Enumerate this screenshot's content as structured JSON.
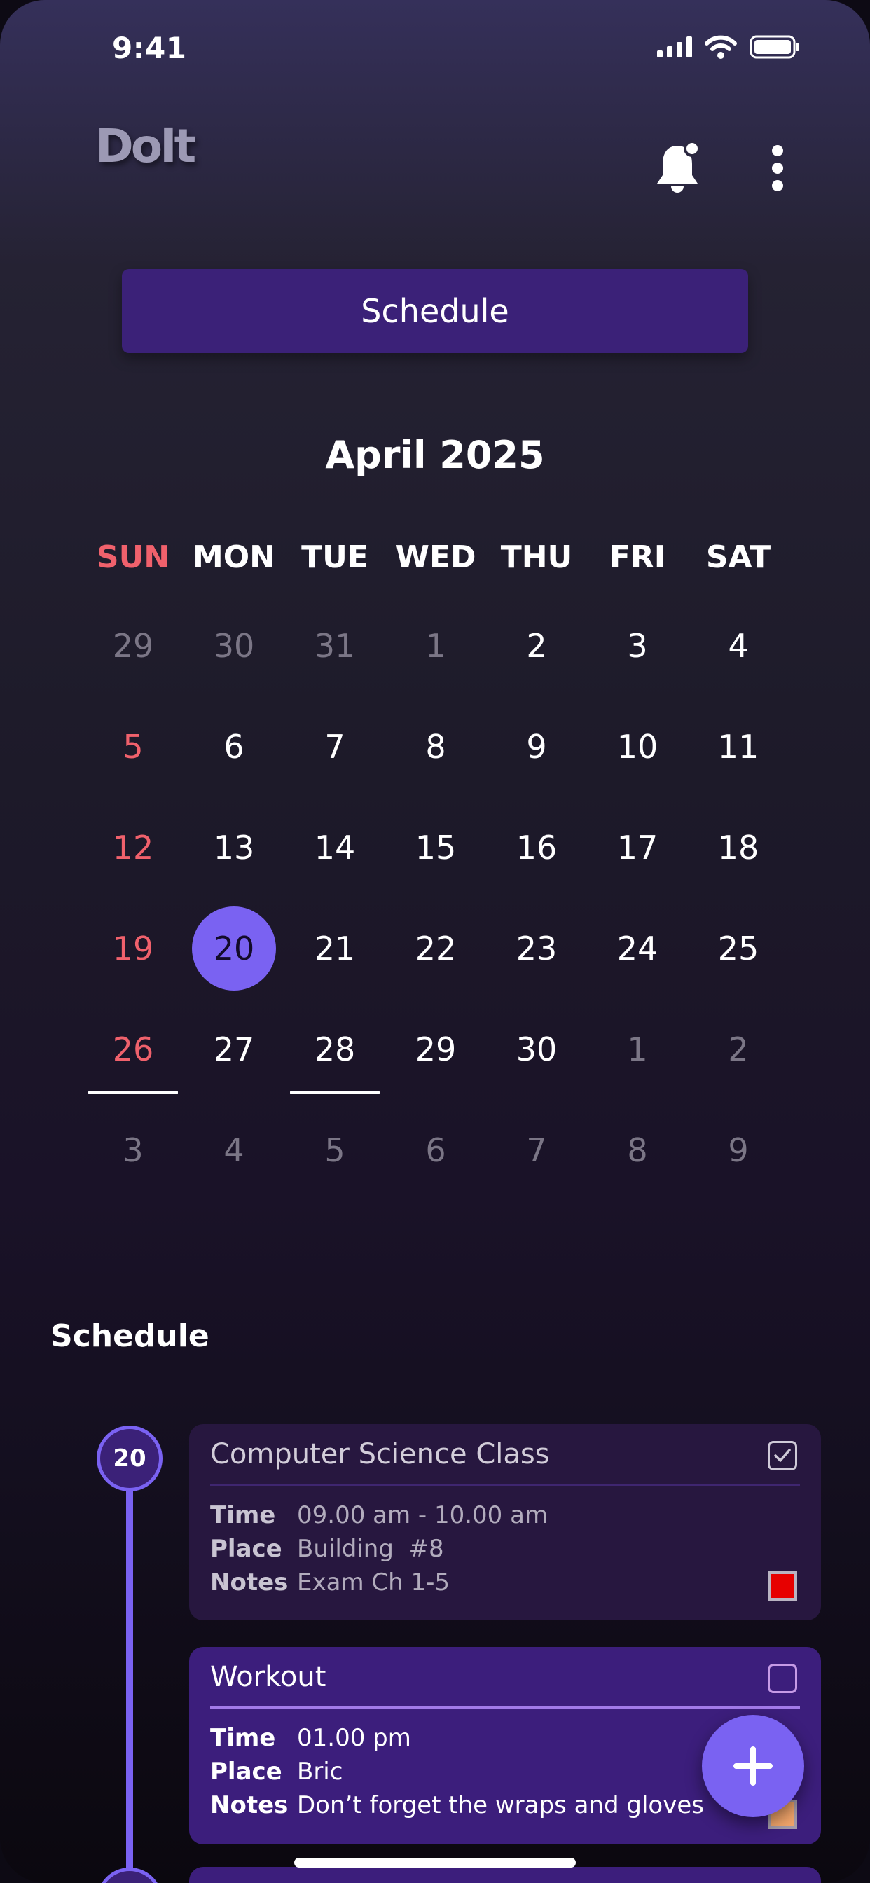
{
  "status_bar": {
    "time": "9:41",
    "icons": [
      "signal-icon",
      "wifi-icon",
      "battery-icon"
    ]
  },
  "header": {
    "logo_text": "DoIt",
    "icons": [
      "bell-icon",
      "more-vertical-icon"
    ]
  },
  "schedule_button": {
    "label": "Schedule"
  },
  "calendar": {
    "title": "April 2025",
    "weekdays": [
      "SUN",
      "MON",
      "TUE",
      "WED",
      "THU",
      "FRI",
      "SAT"
    ],
    "weeks": [
      [
        "29",
        "30",
        "31",
        "1",
        "2",
        "3",
        "4"
      ],
      [
        "5",
        "6",
        "7",
        "8",
        "9",
        "10",
        "11"
      ],
      [
        "12",
        "13",
        "14",
        "15",
        "16",
        "17",
        "18"
      ],
      [
        "19",
        "20",
        "21",
        "22",
        "23",
        "24",
        "25"
      ],
      [
        "26",
        "27",
        "28",
        "29",
        "30",
        "1",
        "2"
      ],
      [
        "3",
        "4",
        "5",
        "6",
        "7",
        "8",
        "9"
      ]
    ],
    "selected_day": "20",
    "days_with_events": [
      "26",
      "28"
    ]
  },
  "schedule": {
    "title": "Schedule",
    "day_badge": "20",
    "items": [
      {
        "title": "Computer Science Class",
        "checked": true,
        "time_label": "Time",
        "time": "09.00 am - 10.00 am",
        "place_label": "Place",
        "place": "Building  #8",
        "notes_label": "Notes",
        "notes": "Exam Ch 1-5",
        "color": "#e70000"
      },
      {
        "title": "Workout",
        "checked": false,
        "time_label": "Time",
        "time": "01.00 pm",
        "place_label": "Place",
        "place": "Bric",
        "notes_label": "Notes",
        "notes": "Don’t forget the wraps and gloves",
        "color": "#f2a56b"
      }
    ]
  },
  "colors": {
    "accent": "#7a62f2",
    "button_bg": "#3b2178",
    "sunday": "#f0616c"
  }
}
